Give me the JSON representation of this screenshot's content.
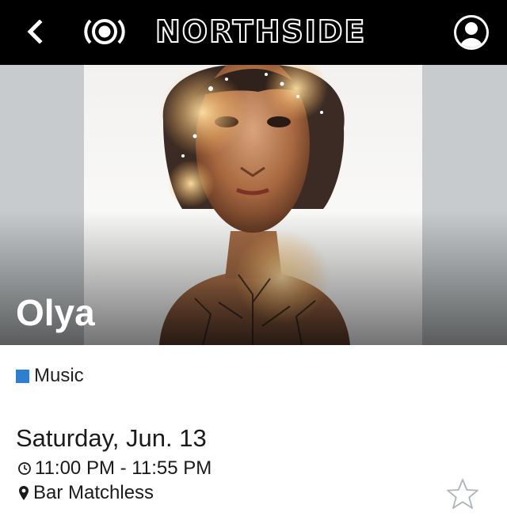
{
  "header": {
    "brand": "NORTHSIDE",
    "back_icon": "chevron-left-icon",
    "logo_icon": "broadcast-target-icon",
    "profile_icon": "user-circle-icon"
  },
  "event": {
    "title": "Olya",
    "category": "Music",
    "category_color": "#2f7fd0",
    "date": "Saturday, Jun. 13",
    "time": "11:00 PM - 11:55 PM",
    "venue": "Bar Matchless",
    "time_icon": "clock-icon",
    "venue_icon": "map-pin-icon",
    "favorite_icon": "star-outline-icon"
  }
}
